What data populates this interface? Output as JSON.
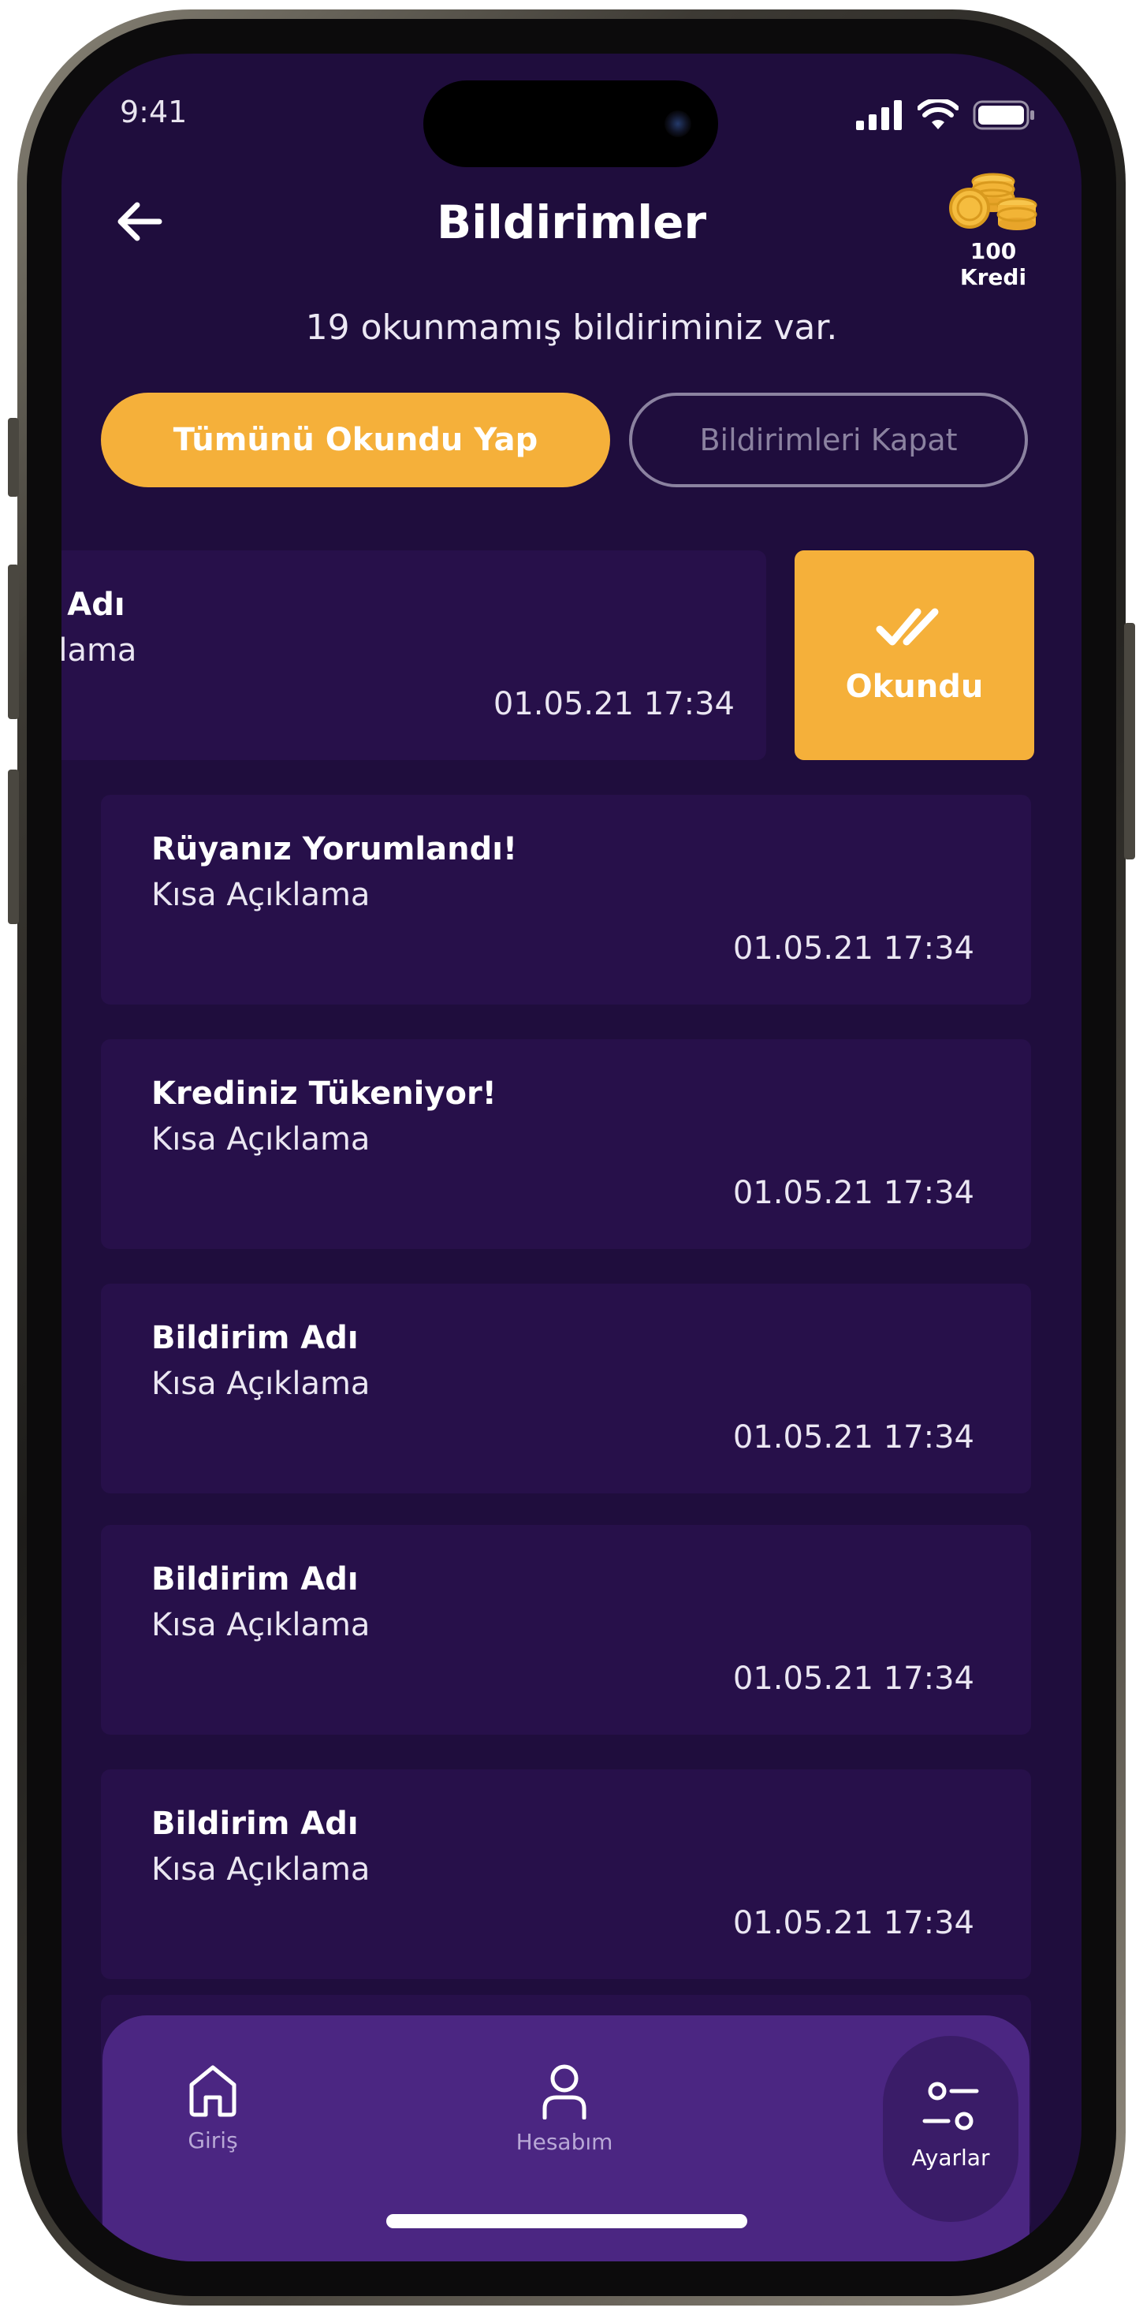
{
  "status_bar": {
    "time": "9:41",
    "icons": [
      "signal-icon",
      "wifi-icon",
      "battery-icon"
    ]
  },
  "header": {
    "title": "Bildirimler",
    "back_icon": "arrow-left-icon",
    "credit": {
      "icon": "coins-icon",
      "label": "100 Kredi"
    }
  },
  "summary": {
    "message": "19 okunmamış bildiriminiz var."
  },
  "actions": {
    "mark_all_read": "Tümünü Okundu Yap",
    "disable_notifications": "Bildirimleri Kapat"
  },
  "swiped_notification": {
    "title": "Bildirim Adı",
    "description": "Kısa Açıklama",
    "time": "01.05.21 17:34",
    "action_label": "Okundu",
    "action_icon": "double-check-icon"
  },
  "notifications": [
    {
      "title": "Rüyanız Yorumlandı!",
      "description": "Kısa Açıklama",
      "time": "01.05.21 17:34"
    },
    {
      "title": "Krediniz Tükeniyor!",
      "description": "Kısa Açıklama",
      "time": "01.05.21 17:34"
    },
    {
      "title": "Bildirim Adı",
      "description": "Kısa Açıklama",
      "time": "01.05.21 17:34"
    },
    {
      "title": "Bildirim Adı",
      "description": "Kısa Açıklama",
      "time": "01.05.21 17:34"
    },
    {
      "title": "Bildirim Adı",
      "description": "Kısa Açıklama",
      "time": "01.05.21 17:34"
    }
  ],
  "tab_bar": {
    "active": "Ayarlar",
    "items": [
      {
        "label": "Giriş",
        "icon": "home-icon"
      },
      {
        "label": "Hesabım",
        "icon": "user-icon"
      },
      {
        "label": "Ayarlar",
        "icon": "settings-sliders-icon"
      }
    ]
  },
  "colors": {
    "background": "#1f0d3d",
    "card": "#27104a",
    "accent": "#f5b03a",
    "tab_bar": "#4b2682"
  }
}
